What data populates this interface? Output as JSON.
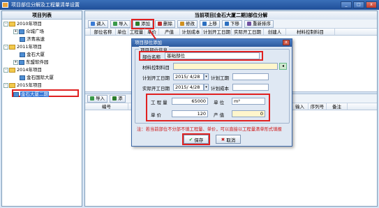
{
  "window": {
    "title": "项目部位分解及工程量清单设置",
    "buttons": [
      "_",
      "□",
      "x"
    ]
  },
  "left_panel": {
    "title": "项目列表",
    "tree": [
      {
        "label": "2010年项目",
        "level": 0,
        "kind": "folder",
        "expander": "-"
      },
      {
        "label": "众城广场",
        "level": 1,
        "kind": "project",
        "expander": "+"
      },
      {
        "label": "济青高速",
        "level": 1,
        "kind": "project",
        "expander": ""
      },
      {
        "label": "2011年项目",
        "level": 0,
        "kind": "folder",
        "expander": "-"
      },
      {
        "label": "金石大厦",
        "level": 1,
        "kind": "project",
        "expander": ""
      },
      {
        "label": "东盟软件园",
        "level": 1,
        "kind": "project",
        "expander": "+"
      },
      {
        "label": "2014年项目",
        "level": 0,
        "kind": "folder",
        "expander": "-"
      },
      {
        "label": "金石国际大厦",
        "level": 1,
        "kind": "project",
        "expander": ""
      },
      {
        "label": "2015年项目",
        "level": 0,
        "kind": "folder",
        "expander": "-"
      },
      {
        "label": "金石大厦二期",
        "level": 1,
        "kind": "project",
        "expander": "",
        "selected": true
      }
    ]
  },
  "right_panel": {
    "title": "当前项目[金石大厦二期]部位分解",
    "toolbar": [
      {
        "label": "调入",
        "icon": "import-icon"
      },
      {
        "label": "导入",
        "icon": "load-icon"
      },
      {
        "label": "添加",
        "icon": "add-icon",
        "highlight": true
      },
      {
        "label": "删除",
        "icon": "delete-icon"
      },
      {
        "label": "修改",
        "icon": "edit-icon"
      },
      {
        "label": "上移",
        "icon": "up-icon"
      },
      {
        "label": "下移",
        "icon": "down-icon"
      },
      {
        "label": "重新排序",
        "icon": "sort-icon"
      }
    ],
    "upper_columns": [
      "部位名称",
      "单位",
      "工程量",
      "单价",
      "产值",
      "计划成本",
      "计划开工日期",
      "实际开工日期",
      "创建人",
      "材料控制科目"
    ],
    "lower_toolbar": [
      {
        "label": "导入",
        "icon": "load-icon"
      },
      {
        "label": "添",
        "icon": "add-icon"
      }
    ],
    "lower_columns": [
      "编号",
      "输入",
      "序列号",
      "备注"
    ]
  },
  "dialog": {
    "title": "项目部位添加",
    "group_title": "项目部位信息",
    "fields": {
      "part_name_label": "部位名称",
      "part_name_value": "基础部位",
      "material_label": "材料控制科目",
      "material_value": "",
      "plan_start_label": "计划开工日期",
      "plan_start_value": "2015/ 4/28",
      "plan_duration_label": "计划工期",
      "plan_duration_value": "",
      "actual_start_label": "实际开工日期",
      "actual_start_value": "2015/ 4/28",
      "plan_cost_label": "计划成本",
      "plan_cost_value": "",
      "quantity_label": "工 程 量",
      "quantity_value": "65000",
      "unit_label": "单    位",
      "unit_value": "m²",
      "price_label": "单    价",
      "price_value": "120",
      "output_label": "产    值",
      "output_value": "0"
    },
    "note": "注：若当前部位不分部不填工程量、单价，可以直接以工程量清单形式填报",
    "save_label": "保存",
    "cancel_label": "取消"
  },
  "colors": {
    "accent": "#3374d6",
    "highlight": "#e02020",
    "title_bar": "#2c5a9e"
  }
}
